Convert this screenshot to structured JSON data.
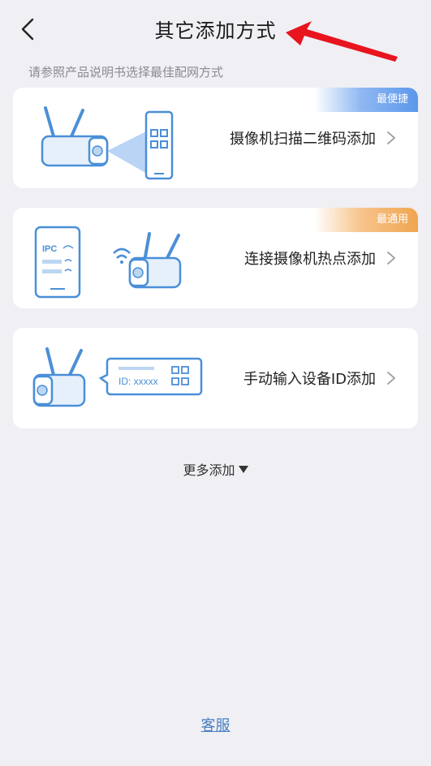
{
  "header": {
    "title": "其它添加方式"
  },
  "subtitle": "请参照产品说明书选择最佳配网方式",
  "cards": [
    {
      "label": "摄像机扫描二维码添加",
      "badge": "最便捷",
      "badge_color": "#5b97ec"
    },
    {
      "label": "连接摄像机热点添加",
      "badge": "最通用",
      "badge_color": "#f0a550"
    },
    {
      "label": "手动输入设备ID添加",
      "badge": ""
    }
  ],
  "illustrations": {
    "phone_ipc_text": "IPC",
    "id_box_text": "ID: xxxxx"
  },
  "more_label": "更多添加",
  "service_label": "客服",
  "colors": {
    "background": "#efeff4",
    "illustration_blue": "#4a8fd8",
    "link": "#4a7fc1",
    "annotation_arrow": "#e8141e"
  }
}
